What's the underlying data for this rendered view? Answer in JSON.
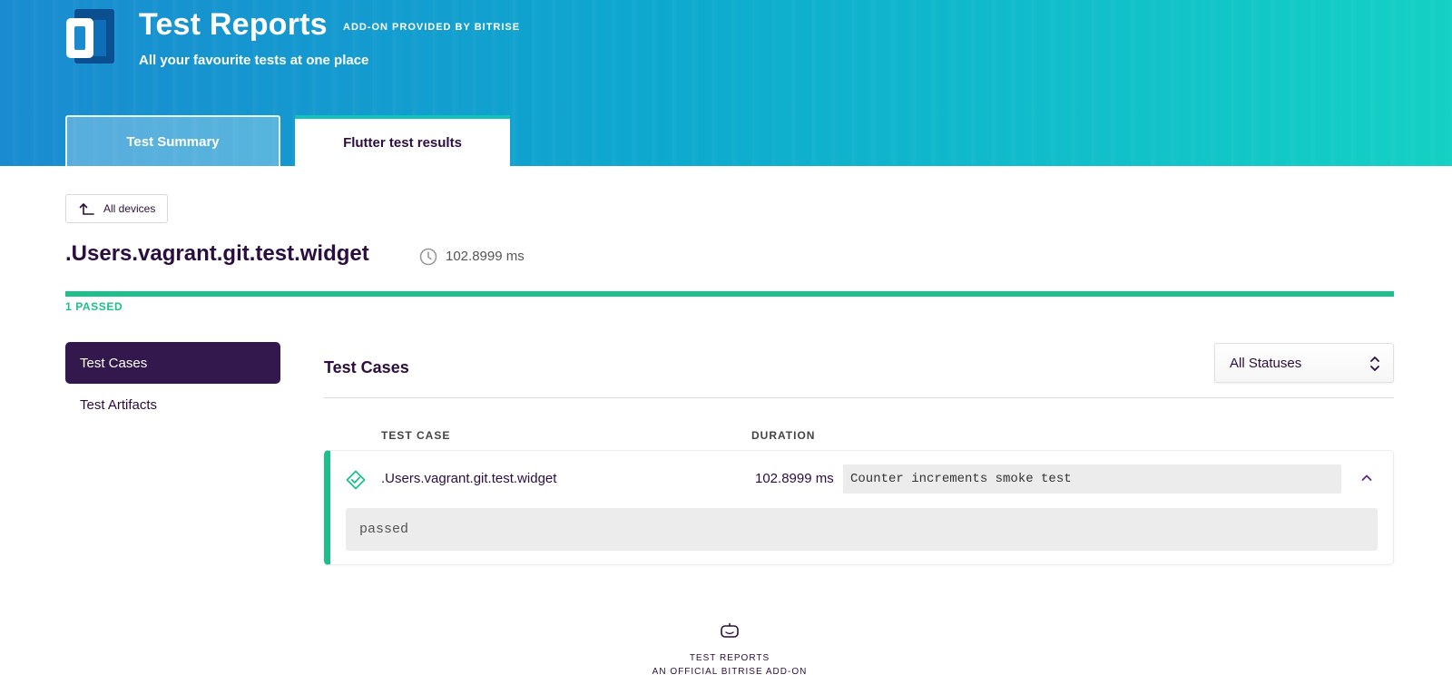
{
  "header": {
    "title": "Test Reports",
    "provided_by": "ADD-ON PROVIDED BY BITRISE",
    "subtitle": "All your favourite tests at one place",
    "tabs": [
      {
        "label": "Test Summary",
        "active": false
      },
      {
        "label": "Flutter test results",
        "active": true
      }
    ],
    "gradient_colors": [
      "#1a8bd0",
      "#14d1c4"
    ]
  },
  "back_button": {
    "label": "All devices",
    "icon": "arrow-up-left-icon"
  },
  "suite": {
    "name": ".Users.vagrant.git.test.widget",
    "duration": "102.8999 ms",
    "passed_label": "1 PASSED",
    "pass_fraction": 1.0,
    "status_color": "#1dbf8a"
  },
  "sidebar": {
    "items": [
      {
        "label": "Test Cases",
        "active": true
      },
      {
        "label": "Test Artifacts",
        "active": false
      }
    ]
  },
  "main": {
    "title": "Test Cases",
    "status_filter": {
      "selected": "All Statuses"
    },
    "columns": [
      "TEST CASE",
      "DURATION"
    ],
    "rows": [
      {
        "name": ".Users.vagrant.git.test.widget",
        "duration": "102.8999 ms",
        "description": "Counter increments smoke test",
        "output": "passed",
        "status": "passed",
        "expanded": true
      }
    ]
  },
  "footer": {
    "line1": "TEST REPORTS",
    "line2": "AN OFFICIAL BITRISE ADD-ON",
    "icon": "robot-icon"
  },
  "colors": {
    "brand_dark": "#33184d",
    "success": "#1dbf8a",
    "tab_accent": "#12c4b8"
  }
}
